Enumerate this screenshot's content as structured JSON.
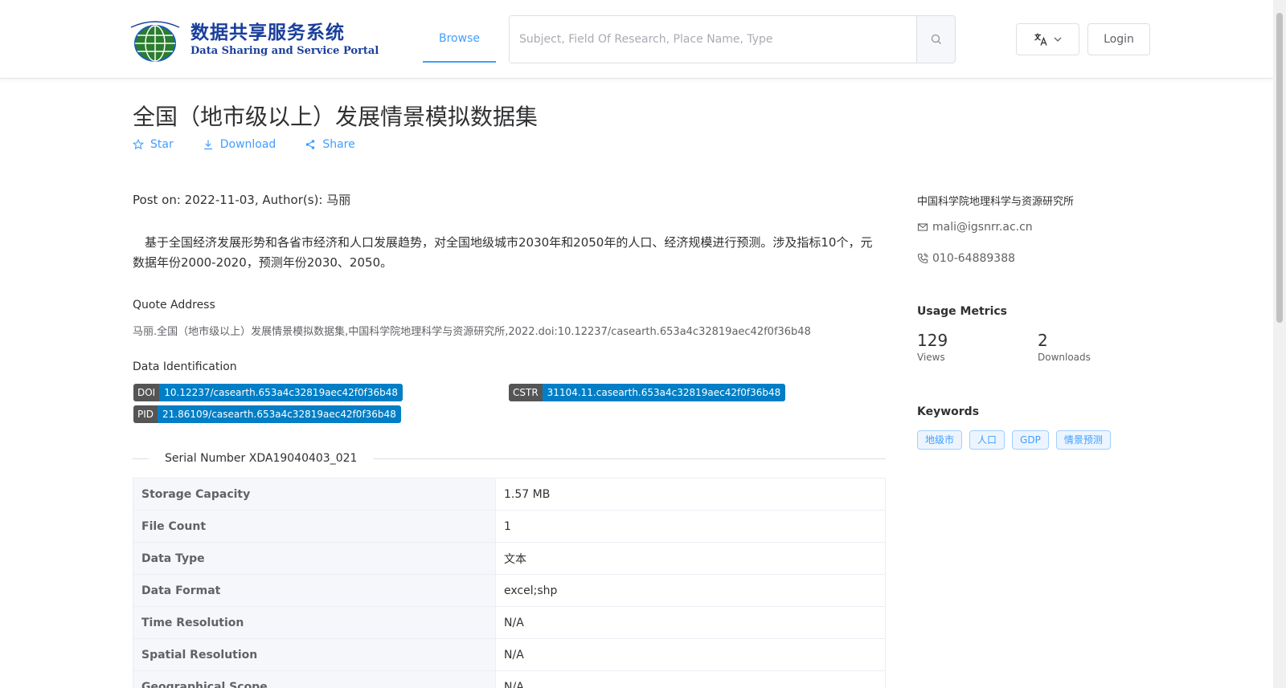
{
  "header": {
    "logo_cn": "数据共享服务系统",
    "logo_en": "Data Sharing and Service Portal",
    "nav_browse": "Browse",
    "search_placeholder": "Subject, Field Of Research, Place Name, Type",
    "login": "Login"
  },
  "dataset": {
    "title": "全国（地市级以上）发展情景模拟数据集",
    "actions": {
      "star": "Star",
      "download": "Download",
      "share": "Share"
    },
    "post_on": "Post on: 2022-11-03, Author(s): 马丽",
    "description": "基于全国经济发展形势和各省市经济和人口发展趋势，对全国地级城市2030年和2050年的人口、经济规模进行预测。涉及指标10个，元数据年份2000-2020，预测年份2030、2050。",
    "quote_heading": "Quote Address",
    "quote_text": "马丽.全国（地市级以上）发展情景模拟数据集,中国科学院地理科学与资源研究所,2022.doi:10.12237/casearth.653a4c32819aec42f0f36b48",
    "ident_heading": "Data Identification",
    "doi_key": "DOI",
    "doi_val": "10.12237/casearth.653a4c32819aec42f0f36b48",
    "cstr_key": "CSTR",
    "cstr_val": "31104.11.casearth.653a4c32819aec42f0f36b48",
    "pid_key": "PID",
    "pid_val": "21.86109/casearth.653a4c32819aec42f0f36b48",
    "serial": "Serial Number XDA19040403_021",
    "properties": [
      {
        "k": "Storage Capacity",
        "v": "1.57 MB"
      },
      {
        "k": "File Count",
        "v": "1"
      },
      {
        "k": "Data Type",
        "v": "文本"
      },
      {
        "k": "Data Format",
        "v": "excel;shp"
      },
      {
        "k": "Time Resolution",
        "v": "N/A"
      },
      {
        "k": "Spatial Resolution",
        "v": "N/A"
      },
      {
        "k": "Geographical Scope",
        "v": "N/A"
      }
    ]
  },
  "sidebar": {
    "org": "中国科学院地理科学与资源研究所",
    "email": "mali@igsnrr.ac.cn",
    "phone": "010-64889388",
    "metrics_heading": "Usage Metrics",
    "views_num": "129",
    "views_label": "Views",
    "downloads_num": "2",
    "downloads_label": "Downloads",
    "keywords_heading": "Keywords",
    "keywords": [
      "地级市",
      "人口",
      "GDP",
      "情景预测"
    ]
  },
  "colors": {
    "accent": "#409eff",
    "badge_key": "#555555",
    "badge_val": "#007ec6",
    "logo": "#1a3f9c"
  }
}
